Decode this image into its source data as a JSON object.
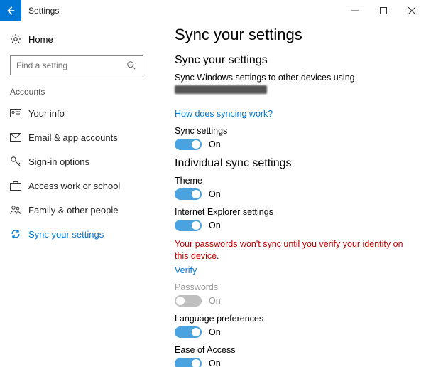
{
  "titlebar": {
    "title": "Settings"
  },
  "sidebar": {
    "home": "Home",
    "searchPlaceholder": "Find a setting",
    "heading": "Accounts",
    "items": [
      {
        "label": "Your info"
      },
      {
        "label": "Email & app accounts"
      },
      {
        "label": "Sign-in options"
      },
      {
        "label": "Access work or school"
      },
      {
        "label": "Family & other people"
      },
      {
        "label": "Sync your settings"
      }
    ]
  },
  "content": {
    "pageTitle": "Sync your settings",
    "section1Title": "Sync your settings",
    "desc": "Sync Windows settings to other devices using",
    "helpLink": "How does syncing work?",
    "syncSettingsLabel": "Sync settings",
    "section2Title": "Individual sync settings",
    "themeLabel": "Theme",
    "ieLabel": "Internet Explorer settings",
    "warning": "Your passwords won't sync until you verify your identity on this device.",
    "verify": "Verify",
    "passwordsLabel": "Passwords",
    "languageLabel": "Language preferences",
    "easeLabel": "Ease of Access",
    "on": "On"
  }
}
